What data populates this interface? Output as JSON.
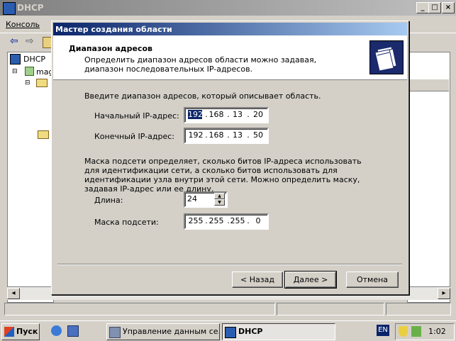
{
  "main_window": {
    "title": "DHCP",
    "controls": [
      "_",
      "□",
      "×"
    ],
    "menu": {
      "console": "Консоль"
    },
    "tree": {
      "root": "DHCP",
      "server": "mag"
    }
  },
  "wizard": {
    "title": "Мастер создания области",
    "header_title": "Диапазон адресов",
    "header_subtitle": "Определить диапазон адресов области можно задавая, диапазон последовательных IP-адресов.",
    "range_instruction": "Введите диапазон адресов, который описывает область.",
    "start_ip": {
      "label": "Начальный IP-адрес:",
      "octets": [
        "192",
        "168",
        "13",
        "20"
      ]
    },
    "end_ip": {
      "label": "Конечный IP-адрес:",
      "octets": [
        "192",
        "168",
        "13",
        "50"
      ]
    },
    "mask_text": "Маска подсети определяет, сколько битов IP-адреса использовать для идентификации сети, а сколько битов использовать для идентификации узла внутри этой сети. Можно определить маску, задавая IP-адрес или ее длину.",
    "length": {
      "label": "Длина:",
      "value": "24"
    },
    "subnet_mask": {
      "label": "Маска подсети:",
      "octets": [
        "255",
        "255",
        "255",
        "0"
      ]
    },
    "buttons": {
      "back": "< Назад",
      "next": "Далее >",
      "cancel": "Отмена"
    }
  },
  "taskbar": {
    "start": "Пуск",
    "tasks": [
      "Управление данным се...",
      "DHCP"
    ],
    "language": "EN",
    "clock": "1:02"
  },
  "colors": {
    "active_title": "#0a246a",
    "active_title_end": "#a6caf0",
    "face": "#d4d0c8"
  }
}
